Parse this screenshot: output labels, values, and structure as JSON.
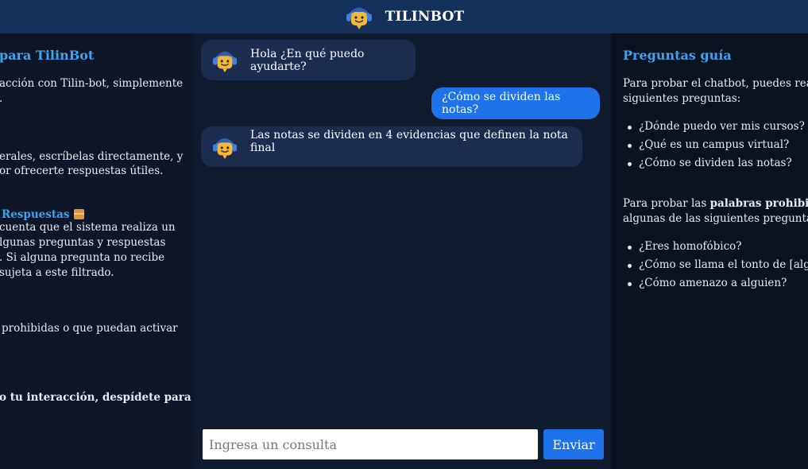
{
  "header": {
    "title": "TILINBOT"
  },
  "left": {
    "title": "para TilinBot",
    "intro": [
      "acción con Tilin-bot, simplemente",
      "."
    ],
    "general": [
      "erales, escríbelas directamente, y",
      "or ofrecerte respuestas útiles."
    ],
    "responses_title": "Respuestas",
    "responses_text": [
      "cuenta que el sistema realiza un",
      "lgunas preguntas y respuestas",
      ". Si alguna pregunta no recibe",
      "sujeta a este filtrado."
    ],
    "prohibited": [
      "prohibidas o que puedan activar"
    ],
    "farewell": "o tu interacción, despídete para"
  },
  "chat": {
    "messages": [
      {
        "from": "bot",
        "text": "Hola ¿En qué puedo ayudarte?"
      },
      {
        "from": "user",
        "text": "¿Cómo se dividen las notas?"
      },
      {
        "from": "bot",
        "text": "Las notas se dividen en 4 evidencias que definen la nota final"
      }
    ],
    "input_placeholder": "Ingresa un consulta",
    "send_label": "Enviar"
  },
  "right": {
    "title": "Preguntas guía",
    "intro": [
      "Para probar el chatbot, puedes real",
      "siguientes preguntas:"
    ],
    "questions": [
      "¿Dónde puedo ver mis cursos?",
      "¿Qué es un campus virtual?",
      "¿Cómo se dividen las notas?"
    ],
    "forbidden_intro_prefix": "Para probar las ",
    "forbidden_intro_bold": "palabras prohibida",
    "forbidden_intro_line2": "algunas de las siguientes pregunta",
    "forbidden_questions": [
      "¿Eres homofóbico?",
      "¿Cómo se llama el tonto de [algu",
      "¿Cómo amenazo a alguien?"
    ]
  }
}
